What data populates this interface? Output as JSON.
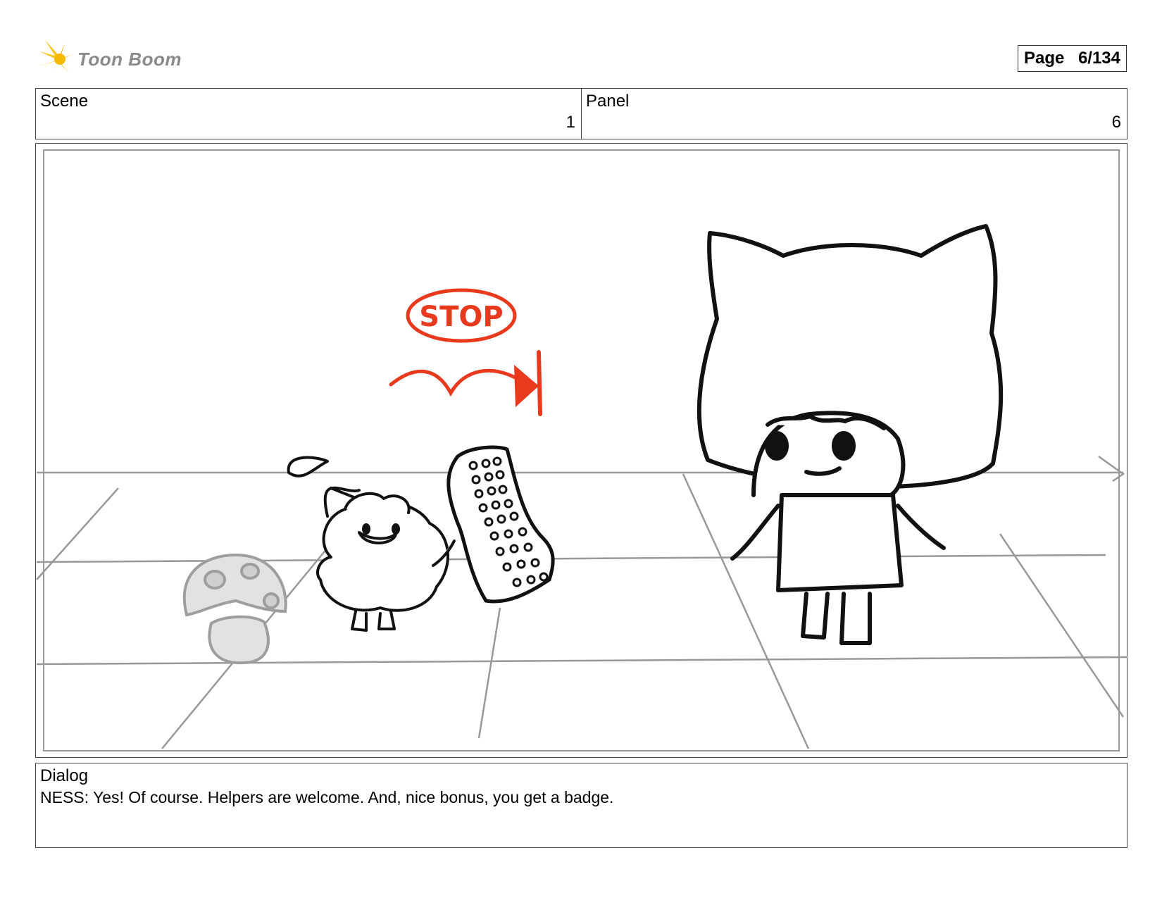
{
  "header": {
    "logo_text": "Toon Boom",
    "page_label": "Page",
    "page_value": "6/134"
  },
  "info": {
    "scene_label": "Scene",
    "scene_value": "1",
    "panel_label": "Panel",
    "panel_value": "6"
  },
  "frame": {
    "stop_label": "STOP"
  },
  "dialog": {
    "label": "Dialog",
    "text": "NESS: Yes! Of course. Helpers are welcome. And, nice bonus, you get a badge."
  },
  "colors": {
    "accent_red": "#ea3a1e",
    "logo_yellow": "#f5c518",
    "logo_gray": "#8a8a8a"
  }
}
